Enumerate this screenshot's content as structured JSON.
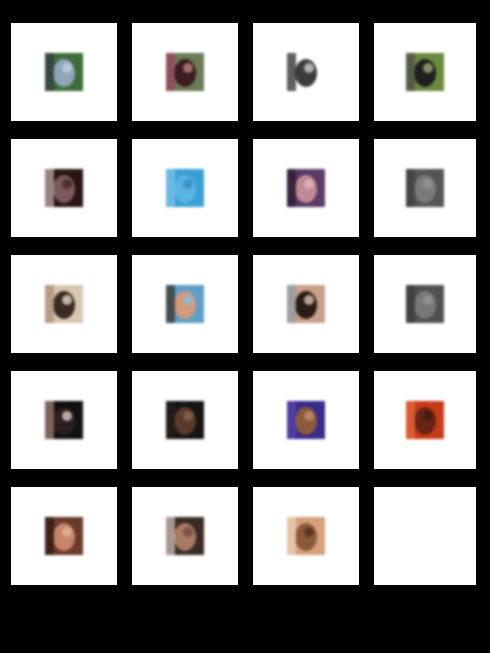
{
  "gallery": {
    "tiles": [
      {
        "icon": "cat-photo-icon",
        "colors": [
          "#3d6b3a",
          "#8fa6b8",
          "#2f3a44",
          "#c9d2d8"
        ]
      },
      {
        "icon": "two-people-photo-icon",
        "colors": [
          "#6b7b55",
          "#3a1c22",
          "#9c3f5c",
          "#c88a78"
        ]
      },
      {
        "icon": "cat-face-icon",
        "colors": [
          "#ffffff",
          "#3b3b3b",
          "#1a1a1a",
          "#d9d9d9"
        ]
      },
      {
        "icon": "dog-photo-icon",
        "colors": [
          "#6b8a3e",
          "#1f1f1f",
          "#4a4a4a",
          "#a9b27a"
        ]
      },
      {
        "icon": "portrait-dark-icon",
        "colors": [
          "#2a1414",
          "#7a5a5a",
          "#c9b0b0",
          "#3c2424"
        ]
      },
      {
        "icon": "blue-square-icon",
        "colors": [
          "#3a9fd4",
          "#5ab3e0",
          "#7ec6ea",
          "#2c8cc2"
        ]
      },
      {
        "icon": "woman-purple-photo-icon",
        "colors": [
          "#5a3a66",
          "#c08a96",
          "#2a1a2e",
          "#e0b8b8"
        ]
      },
      {
        "icon": "gray-photo-icon",
        "colors": [
          "#555555",
          "#7a7a7a",
          "#3e3e3e",
          "#9a9a9a"
        ]
      },
      {
        "icon": "eye-closeup-icon",
        "colors": [
          "#d8c6b0",
          "#3a2a20",
          "#a88c74",
          "#f0e4d8"
        ]
      },
      {
        "icon": "face-blue-photo-icon",
        "colors": [
          "#5aa0c8",
          "#d49a7c",
          "#3a2a20",
          "#8ac0dc"
        ]
      },
      {
        "icon": "twin-faces-photo-icon",
        "colors": [
          "#c8a088",
          "#2a1c14",
          "#8a9cac",
          "#e8d0c0"
        ]
      },
      {
        "icon": "gray-photo-icon",
        "colors": [
          "#505050",
          "#787878",
          "#3a3a3a",
          "#989898"
        ]
      },
      {
        "icon": "dark-hair-photo-icon",
        "colors": [
          "#111111",
          "#2a2020",
          "#a88878",
          "#e8d8d0"
        ]
      },
      {
        "icon": "man-dark-photo-icon",
        "colors": [
          "#141414",
          "#5a3a2a",
          "#2a1e18",
          "#8a6a54"
        ]
      },
      {
        "icon": "woman-headscarf-photo-icon",
        "colors": [
          "#3a2a8a",
          "#8a5a3a",
          "#5a44b0",
          "#c8946c"
        ]
      },
      {
        "icon": "red-portrait-photo-icon",
        "colors": [
          "#c83a1a",
          "#6a2414",
          "#e06a3a",
          "#3a1a10"
        ]
      },
      {
        "icon": "girl-portrait-photo-icon",
        "colors": [
          "#6a3a2a",
          "#c8846a",
          "#2a1810",
          "#e8b8a0"
        ]
      },
      {
        "icon": "smiling-man-photo-icon",
        "colors": [
          "#3a2a24",
          "#a87a64",
          "#d8c8c0",
          "#6a4a3c"
        ]
      },
      {
        "icon": "child-face-photo-icon",
        "colors": [
          "#d8a07a",
          "#8a5a3a",
          "#f0d0b8",
          "#4a3020"
        ]
      },
      {
        "icon": "empty-tile",
        "colors": []
      }
    ]
  }
}
